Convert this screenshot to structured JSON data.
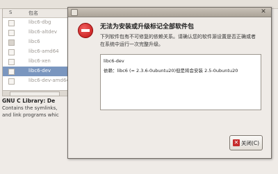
{
  "background": {
    "menu": [
      "",
      "",
      "",
      "",
      "",
      ""
    ],
    "header": {
      "col_status": "S",
      "col_name": "包名"
    },
    "packages": [
      {
        "name": "libc6-dbg",
        "checked": false,
        "selected": false
      },
      {
        "name": "libc6-altdev",
        "checked": false,
        "selected": false
      },
      {
        "name": "libc6",
        "checked": true,
        "selected": false
      },
      {
        "name": "libc6-amd64",
        "checked": false,
        "selected": false
      },
      {
        "name": "libc6-xen",
        "checked": false,
        "selected": false
      },
      {
        "name": "libc6-dev",
        "checked": false,
        "selected": true
      },
      {
        "name": "libc6-dev-amd64",
        "checked": false,
        "selected": false
      }
    ],
    "description": {
      "title": "GNU C Library: De",
      "lines": [
        "Contains the symlinks,",
        "and link programs whic"
      ]
    }
  },
  "dialog": {
    "heading": "无法为安装或升级标记全部软件包",
    "message_lines": [
      "下列软件包有不可修复的依赖关系。请确认您的软件源设置是否正确或者",
      "在系统中运行一次完整升级。"
    ],
    "details": [
      "libc6-dev",
      "依赖：libc6 (= 2.3.6-0ubuntu20)但是将会安装 2.5-0ubuntu20"
    ],
    "close_label": "关闭(C)",
    "colors": {
      "error": "#c01212",
      "selection": "#7a96bf"
    }
  }
}
